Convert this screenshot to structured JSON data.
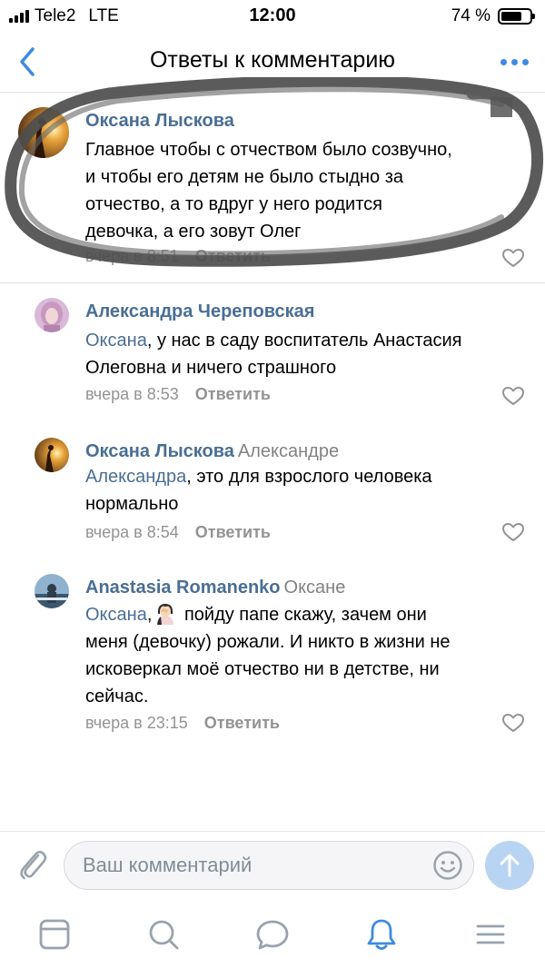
{
  "status_bar": {
    "carrier": "Tele2",
    "network": "LTE",
    "time": "12:00",
    "battery_text": "74 %",
    "battery_level": 0.74
  },
  "header": {
    "title": "Ответы к комментарию",
    "back_icon": "chevron-left-icon",
    "more_icon": "more-dots-icon",
    "accent_color": "#3f8ae0"
  },
  "comments": [
    {
      "author": "Оксана Лыскова",
      "reply_to": "",
      "mention": "",
      "text_lines": [
        "Главное чтобы с отчеством было созвучно,",
        "и чтобы его детям не было стыдно за",
        "отчество, а то вдруг у него родится",
        "девочка, а его зовут Олег"
      ],
      "time": "вчера в 8:51",
      "reply_label": "Ответить"
    },
    {
      "author": "Александра Череповская",
      "reply_to": "",
      "mention": "Оксана",
      "text_first": ", у нас в саду воспитатель Анастасия",
      "text_lines": [
        "Олеговна и ничего страшного"
      ],
      "time": "вчера в 8:53",
      "reply_label": "Ответить"
    },
    {
      "author": "Оксана Лыскова",
      "reply_to": "Александре",
      "mention": "Александра",
      "text_first": ", это для взрослого человека",
      "text_lines": [
        "нормально"
      ],
      "time": "вчера в 8:54",
      "reply_label": "Ответить"
    },
    {
      "author": "Anastasia Romanenko",
      "reply_to": "Оксане",
      "mention": "Оксана",
      "text_first": " пойду папе скажу, зачем они",
      "text_lines": [
        "меня (девочку) рожали. И никто в жизни не",
        "исковеркал моё отчество ни в детстве, ни",
        "сейчас."
      ],
      "time": "вчера в 23:15",
      "reply_label": "Ответить",
      "emoji": "person-facepalm-icon"
    }
  ],
  "composer": {
    "placeholder": "Ваш комментарий",
    "attach_icon": "paperclip-icon",
    "emoji_icon": "smiley-icon",
    "send_icon": "arrow-up-icon"
  },
  "tab_bar": {
    "tabs": [
      "feed-icon",
      "search-icon",
      "messages-icon",
      "notifications-icon",
      "menu-icon"
    ],
    "active": "notifications-icon"
  }
}
